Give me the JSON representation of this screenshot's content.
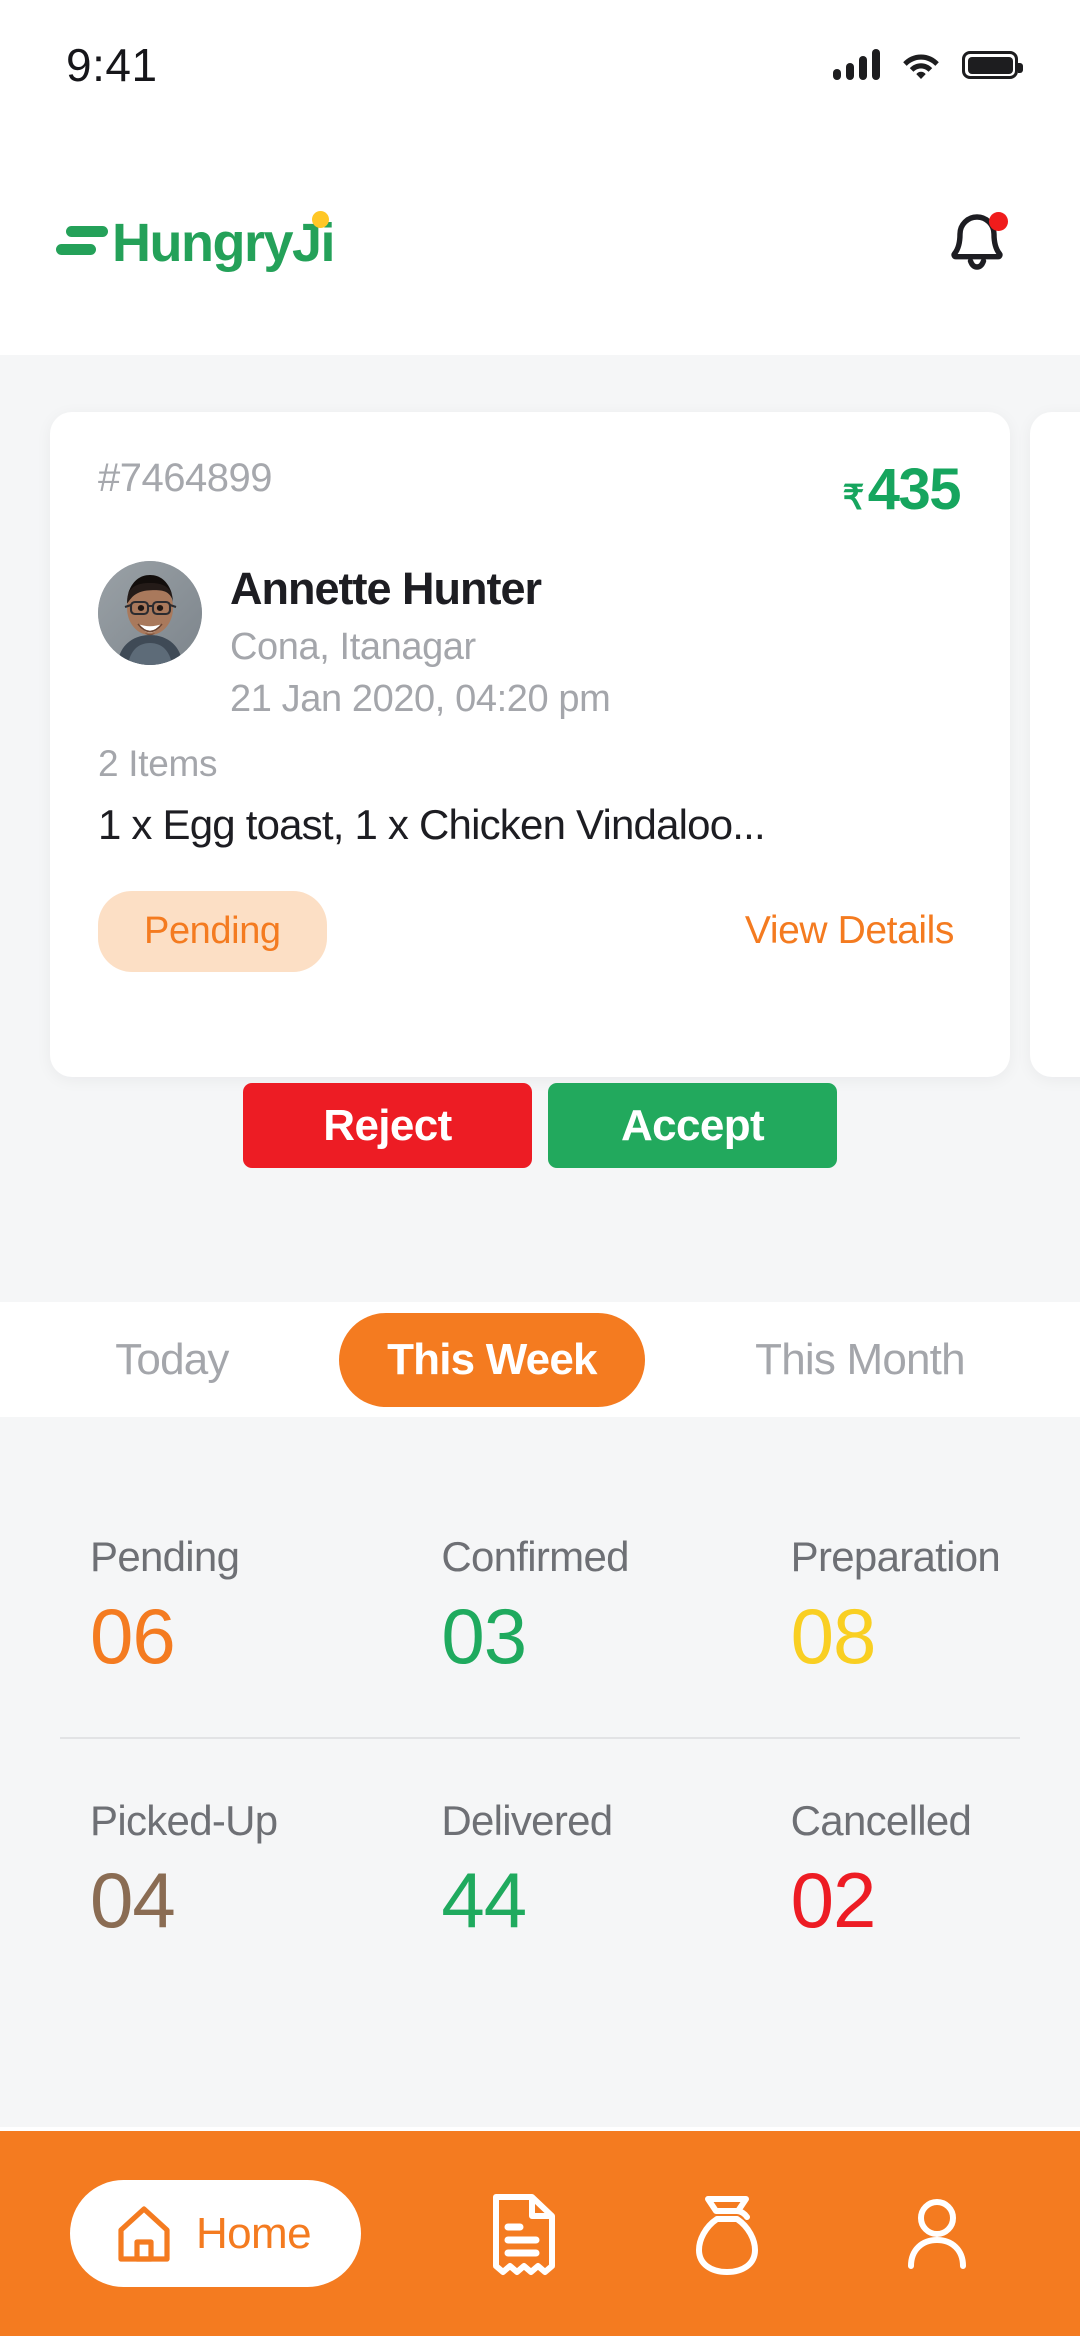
{
  "status_bar": {
    "time": "9:41",
    "signal_icon": "cellular-signal-icon",
    "wifi_icon": "wifi-icon",
    "battery_icon": "battery-full-icon"
  },
  "header": {
    "logo_text": "HungryJi",
    "logo_mark": "hungryji-logo-mark",
    "brand_green": "#24a159",
    "brand_dot_yellow": "#ffc726",
    "notification_icon": "bell-icon",
    "notification_dot_color": "#f01c1c",
    "has_unread": true
  },
  "order_card": {
    "order_id": "#7464899",
    "currency_symbol": "₹",
    "price": "435",
    "price_color": "#16a55e",
    "customer_name": "Annette Hunter",
    "customer_address": "Cona, Itanagar",
    "order_time": "21 Jan 2020, 04:20 pm",
    "items_count": "2 Items",
    "items_list": "1 x Egg toast, 1 x Chicken Vindaloo...",
    "status_badge": "Pending",
    "status_badge_bg": "#fcdfc5",
    "status_badge_color": "#f47b20",
    "view_details_label": "View Details"
  },
  "actions": {
    "reject_label": "Reject",
    "reject_color": "#ed1c24",
    "accept_label": "Accept",
    "accept_color": "#22a95d"
  },
  "filter_tabs": {
    "active_index": 1,
    "active_color": "#f47b20",
    "items": [
      {
        "label": "Today",
        "active": false
      },
      {
        "label": "This Week",
        "active": true
      },
      {
        "label": "This Month",
        "active": false
      }
    ]
  },
  "stats": {
    "rows": [
      [
        {
          "label": "Pending",
          "value": "06",
          "color": "#f47b20"
        },
        {
          "label": "Confirmed",
          "value": "03",
          "color": "#1faa5e"
        },
        {
          "label": "Preparation",
          "value": "08",
          "color": "#f9cf22"
        }
      ],
      [
        {
          "label": "Picked-Up",
          "value": "04",
          "color": "#8a6c53"
        },
        {
          "label": "Delivered",
          "value": "44",
          "color": "#1faa5e"
        },
        {
          "label": "Cancelled",
          "value": "02",
          "color": "#ed1c24"
        }
      ]
    ]
  },
  "bottom_nav": {
    "background": "#f47b20",
    "items": [
      {
        "label": "Home",
        "icon": "home-icon",
        "active": true
      },
      {
        "label": "",
        "icon": "receipt-icon",
        "active": false
      },
      {
        "label": "",
        "icon": "money-bag-icon",
        "active": false
      },
      {
        "label": "",
        "icon": "profile-icon",
        "active": false
      }
    ]
  }
}
